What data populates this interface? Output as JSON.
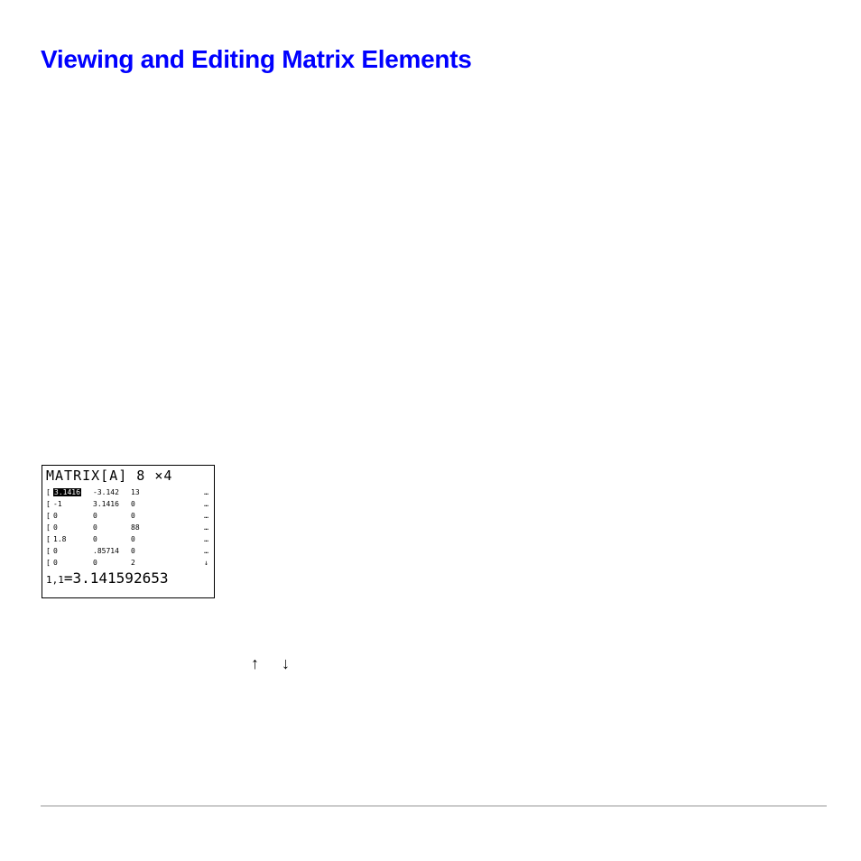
{
  "heading": "Viewing and Editing Matrix Elements",
  "calc": {
    "header": "MATRIX[A]  8 ×4",
    "rows": [
      {
        "lb": "[",
        "c1": "3.1416",
        "c1_sel": true,
        "c2": "-3.142",
        "c3": "13",
        "tail": "…"
      },
      {
        "lb": "[",
        "c1": "-1",
        "c1_sel": false,
        "c2": "3.1416",
        "c3": "0",
        "tail": "…"
      },
      {
        "lb": "[",
        "c1": "0",
        "c1_sel": false,
        "c2": "0",
        "c3": "0",
        "tail": "…"
      },
      {
        "lb": "[",
        "c1": "0",
        "c1_sel": false,
        "c2": "0",
        "c3": "88",
        "tail": "…"
      },
      {
        "lb": "[",
        "c1": "1.8",
        "c1_sel": false,
        "c2": "0",
        "c3": "0",
        "tail": "…"
      },
      {
        "lb": "[",
        "c1": "0",
        "c1_sel": false,
        "c2": ".85714",
        "c3": "0",
        "tail": "…"
      },
      {
        "lb": "[",
        "c1": "0",
        "c1_sel": false,
        "c2": "0",
        "c3": "2",
        "tail": "↓"
      }
    ],
    "footer_idx": "1,1",
    "footer_val": "=3.141592653"
  },
  "arrows": {
    "up": "↑",
    "down": "↓"
  }
}
